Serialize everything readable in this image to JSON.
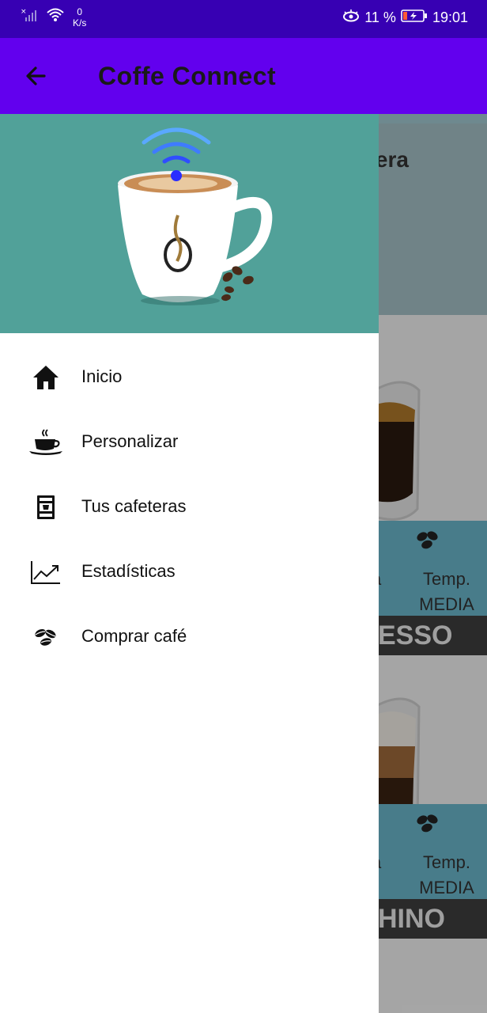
{
  "status_bar": {
    "net_speed_value": "0",
    "net_speed_unit": "K/s",
    "battery_percent": "11 %",
    "time": "19:01"
  },
  "app_bar": {
    "title": "Coffe Connect"
  },
  "background": {
    "header_title_fragment": "etera",
    "cards": [
      {
        "temp_label": "Temp.",
        "temp_value": "MEDIA",
        "left_fragment": "a",
        "name_fragment": "ESSO"
      },
      {
        "temp_label": "Temp.",
        "temp_value": "MEDIA",
        "left_fragment": "a",
        "name_fragment": "HINO"
      }
    ]
  },
  "drawer": {
    "items": [
      {
        "label": "Inicio",
        "icon": "home-icon"
      },
      {
        "label": "Personalizar",
        "icon": "coffee-cup-icon"
      },
      {
        "label": "Tus cafeteras",
        "icon": "coffee-machine-icon"
      },
      {
        "label": "Estadísticas",
        "icon": "chart-line-icon"
      },
      {
        "label": "Comprar café",
        "icon": "coffee-beans-icon"
      }
    ]
  },
  "colors": {
    "status_bar": "#3700b3",
    "app_bar": "#6200ee",
    "drawer_header": "#51a199",
    "info_band": "#6bb7cc"
  }
}
